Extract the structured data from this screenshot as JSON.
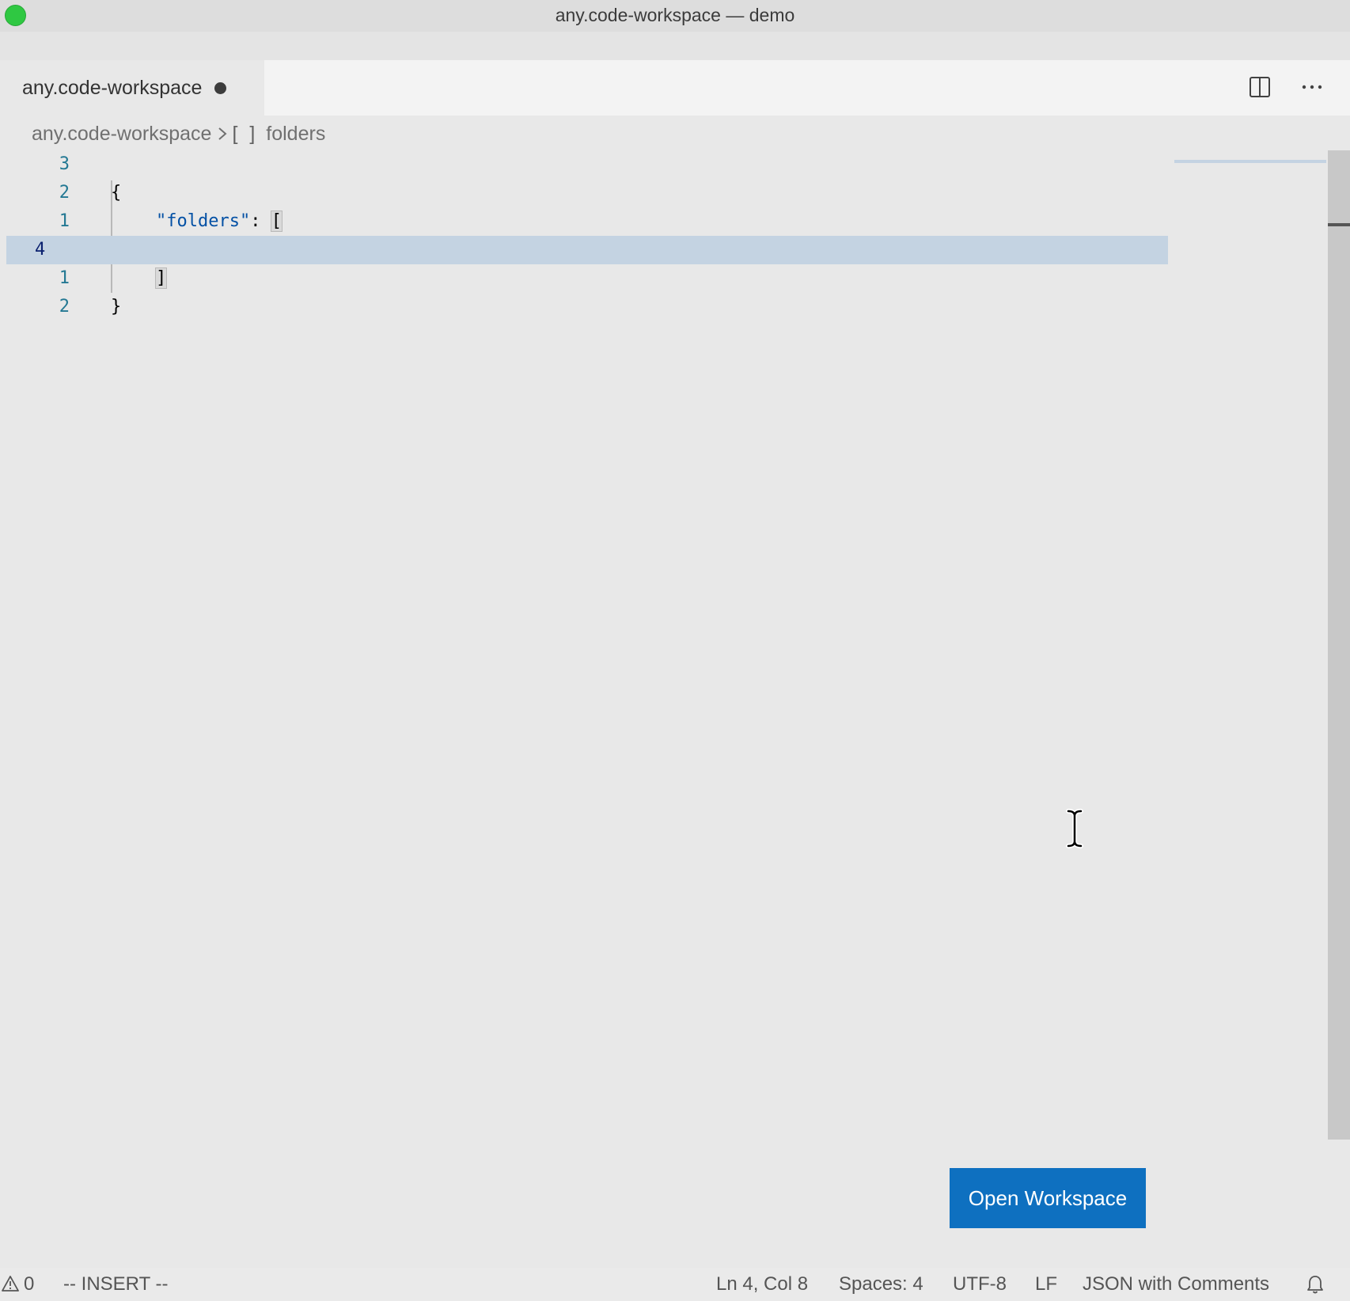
{
  "window": {
    "title": "any.code-workspace — demo"
  },
  "tab": {
    "label": "any.code-workspace",
    "dirty": true
  },
  "breadcrumb": {
    "file": "any.code-workspace",
    "symbol_icon": "[ ]",
    "symbol": "folders"
  },
  "editor": {
    "lines": [
      {
        "number": "3",
        "text": ""
      },
      {
        "number": "2",
        "text": "{"
      },
      {
        "number": "1",
        "key": "\"folders\"",
        "rest": ": ",
        "bracket": "["
      },
      {
        "number": "4",
        "text": "",
        "current": true
      },
      {
        "number": "1",
        "bracket": "]"
      },
      {
        "number": "2",
        "text": "}"
      }
    ]
  },
  "actions": {
    "open_workspace_label": "Open Workspace"
  },
  "statusbar": {
    "warnings": "0",
    "mode": "-- INSERT --",
    "position": "Ln 4, Col 8",
    "spaces": "Spaces: 4",
    "encoding": "UTF-8",
    "eol": "LF",
    "language": "JSON with Comments"
  },
  "colors": {
    "accent": "#0e70c0",
    "current_line": "#c4d3e2",
    "string": "#0451a5",
    "line_number": "#237893",
    "traffic_green": "#2fc842"
  },
  "icons": [
    "split-editor-icon",
    "more-actions-icon",
    "chevron-right-icon",
    "warning-icon",
    "bell-icon"
  ]
}
